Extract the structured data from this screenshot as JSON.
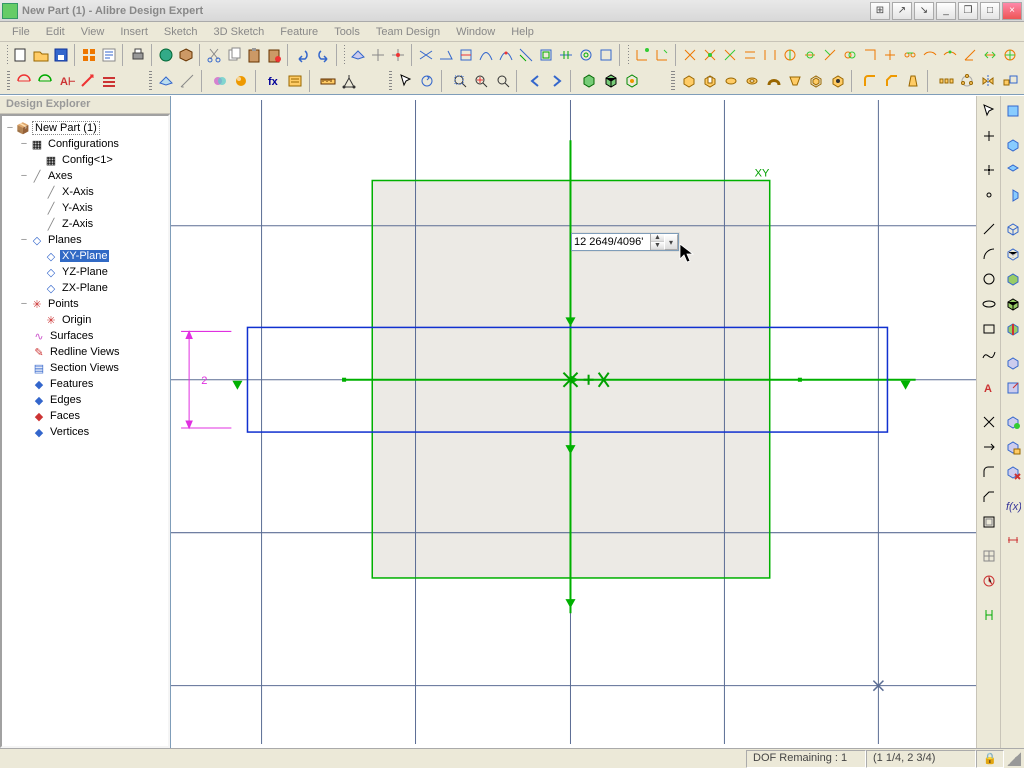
{
  "window": {
    "title": "New Part (1) - Alibre Design Expert",
    "controls": {
      "min": "_",
      "max": "□",
      "close": "×",
      "pin": "↘",
      "unpin": "↗"
    }
  },
  "menus": [
    "File",
    "Edit",
    "View",
    "Insert",
    "Sketch",
    "3D Sketch",
    "Feature",
    "Tools",
    "Team Design",
    "Window",
    "Help"
  ],
  "explorer": {
    "title": "Design Explorer",
    "root": "New Part (1)",
    "nodes": {
      "configurations": "Configurations",
      "config1": "Config<1>",
      "axes": "Axes",
      "xaxis": "X-Axis",
      "yaxis": "Y-Axis",
      "zaxis": "Z-Axis",
      "planes": "Planes",
      "xy": "XY-Plane",
      "yz": "YZ-Plane",
      "zx": "ZX-Plane",
      "points": "Points",
      "origin": "Origin",
      "surfaces": "Surfaces",
      "redline": "Redline Views",
      "section": "Section Views",
      "features": "Features",
      "edges": "Edges",
      "faces": "Faces",
      "vertices": "Vertices"
    }
  },
  "canvas": {
    "xy_label": "XY",
    "dimension_label": "2",
    "float_input_value": "12 2649/4096'"
  },
  "status": {
    "dof": "DOF Remaining : 1",
    "coord": "(1 1/4, 2 3/4)"
  },
  "colors": {
    "grid": "#6677aa",
    "construction": "#00c000",
    "sketch": "#1030d0",
    "magenta": "#e030e0",
    "panel": "#ece9d8",
    "select": "#316ac5"
  }
}
